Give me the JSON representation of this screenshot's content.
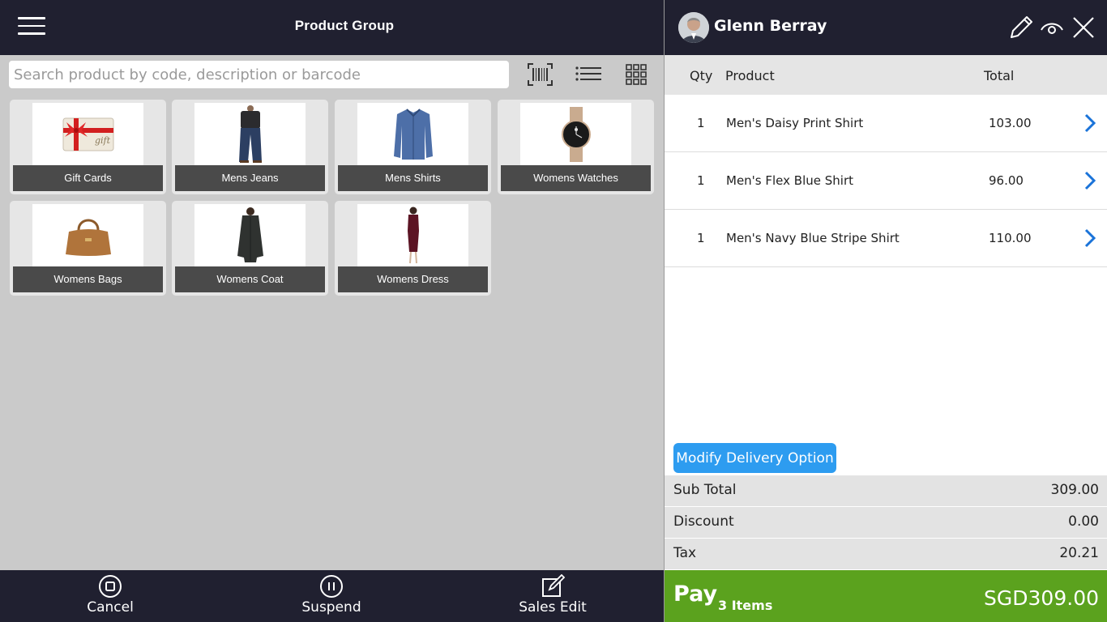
{
  "header": {
    "title": "Product Group"
  },
  "search": {
    "placeholder": "Search product by code, description or barcode"
  },
  "groups": [
    {
      "label": "Gift Cards",
      "icon": "gift-card-image"
    },
    {
      "label": "Mens Jeans",
      "icon": "jeans-image"
    },
    {
      "label": "Mens Shirts",
      "icon": "shirt-image"
    },
    {
      "label": "Womens Watches",
      "icon": "watch-image"
    },
    {
      "label": "Womens Bags",
      "icon": "handbag-image"
    },
    {
      "label": "Womens Coat",
      "icon": "coat-image"
    },
    {
      "label": "Womens Dress",
      "icon": "dress-image"
    }
  ],
  "bottom": {
    "cancel": "Cancel",
    "suspend": "Suspend",
    "sales_edit": "Sales Edit"
  },
  "customer": {
    "name": "Glenn Berray"
  },
  "cart": {
    "columns": {
      "qty": "Qty",
      "product": "Product",
      "total": "Total"
    },
    "items": [
      {
        "qty": "1",
        "product": "Men's Daisy Print Shirt",
        "total": "103.00"
      },
      {
        "qty": "1",
        "product": "Men's Flex Blue Shirt",
        "total": "96.00"
      },
      {
        "qty": "1",
        "product": "Men's Navy Blue Stripe Shirt",
        "total": "110.00"
      }
    ]
  },
  "delivery_button": "Modify Delivery Option",
  "summary": {
    "subtotal_label": "Sub Total",
    "subtotal": "309.00",
    "discount_label": "Discount",
    "discount": "0.00",
    "tax_label": "Tax",
    "tax": "20.21"
  },
  "pay": {
    "label": "Pay",
    "items": "3 Items",
    "total": "SGD309.00"
  },
  "colors": {
    "header_bg": "#202030",
    "pay_green": "#5ba21e",
    "accent_blue": "#2d9cf0",
    "chevron_blue": "#1a73d9"
  }
}
